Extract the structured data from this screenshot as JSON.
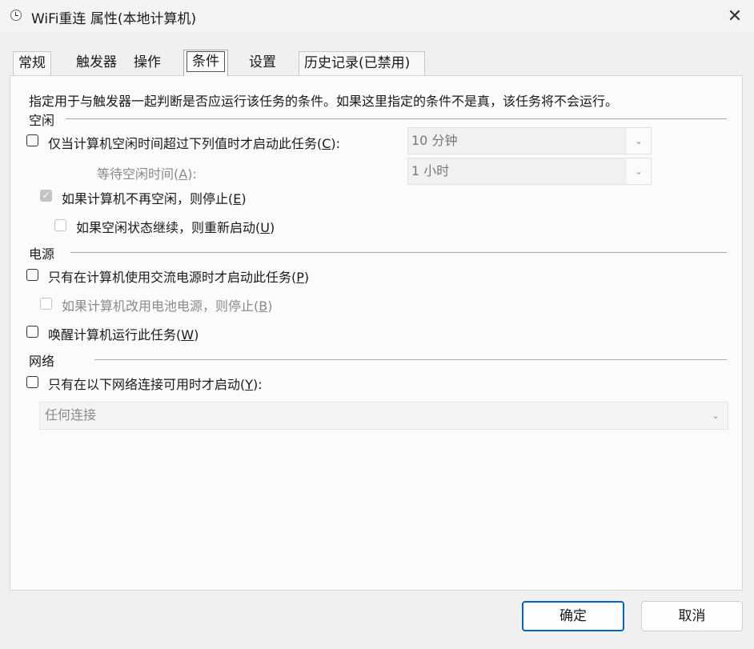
{
  "window": {
    "title": "WiFi重连 属性(本地计算机)",
    "close_symbol": "✕"
  },
  "tabs": [
    {
      "label": "常规"
    },
    {
      "label": "触发器"
    },
    {
      "label": "操作"
    },
    {
      "label": "条件",
      "active": true
    },
    {
      "label": "设置"
    },
    {
      "label": "历史记录(已禁用)"
    }
  ],
  "description": "指定用于与触发器一起判断是否应运行该任务的条件。如果这里指定的条件不是真，该任务将不会运行。",
  "idle": {
    "section": "空闲",
    "start_if_idle": {
      "label": "仅当计算机空闲时间超过下列值时才启动此任务(",
      "key": "C",
      "suffix": "):",
      "checked": false
    },
    "idle_duration": "10 分钟",
    "wait_label": {
      "label": "等待空闲时间(",
      "key": "A",
      "suffix": "):"
    },
    "wait_duration": "1 小时",
    "stop_if_not_idle": {
      "label": "如果计算机不再空闲，则停止(",
      "key": "E",
      "suffix": ")",
      "checked": true
    },
    "restart_if_idle": {
      "label": "如果空闲状态继续，则重新启动(",
      "key": "U",
      "suffix": ")",
      "checked": false
    }
  },
  "power": {
    "section": "电源",
    "ac_only": {
      "label": "只有在计算机使用交流电源时才启动此任务(",
      "key": "P",
      "suffix": ")",
      "checked": false
    },
    "stop_on_battery": {
      "label": "如果计算机改用电池电源，则停止(",
      "key": "B",
      "suffix": ")",
      "checked": false
    },
    "wake": {
      "label": "唤醒计算机运行此任务(",
      "key": "W",
      "suffix": ")",
      "checked": false
    }
  },
  "network": {
    "section": "网络",
    "only_if_network": {
      "label": "只有在以下网络连接可用时才启动(",
      "key": "Y",
      "suffix": "):",
      "checked": false
    },
    "connection": "任何连接"
  },
  "buttons": {
    "ok": "确定",
    "cancel": "取消"
  },
  "colors": {
    "primary_border": "#0067c0",
    "disabled_text": "#8a8a8a"
  }
}
